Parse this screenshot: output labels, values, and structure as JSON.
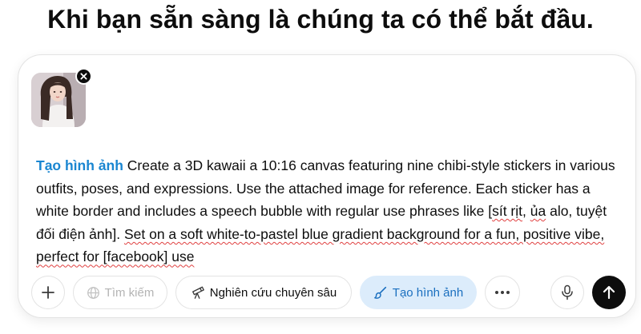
{
  "heading": "Khi bạn sẵn sàng là chúng ta có thể bắt đầu.",
  "prompt": {
    "tag": "Tạo hình ảnh",
    "text_part1": " Create a 3D kawaii a 10:16 canvas featuring nine chibi-style stickers in various outfits, poses, and expressions. Use the attached image for reference. Each sticker has a white border and includes a speech bubble with regular use phrases like [",
    "squiggle1": "sít rịt",
    "text_part2": ", ",
    "squiggle2": "ủa",
    "text_part3": " alo, tuyệt đối điện ảnh]. ",
    "squiggle3": "Set on a soft white-to-pastel blue gradient background for a fun, positive vibe, perfect for [facebook] use"
  },
  "attachment": {
    "alt": "attached reference image"
  },
  "toolbar": {
    "search_label": "Tìm kiếm",
    "deep_research_label": "Nghiên cứu chuyên sâu",
    "create_image_label": "Tạo hình ảnh"
  },
  "colors": {
    "accent": "#1a86d1",
    "active_bg": "#dcecfb",
    "send_bg": "#0d0d0d"
  }
}
